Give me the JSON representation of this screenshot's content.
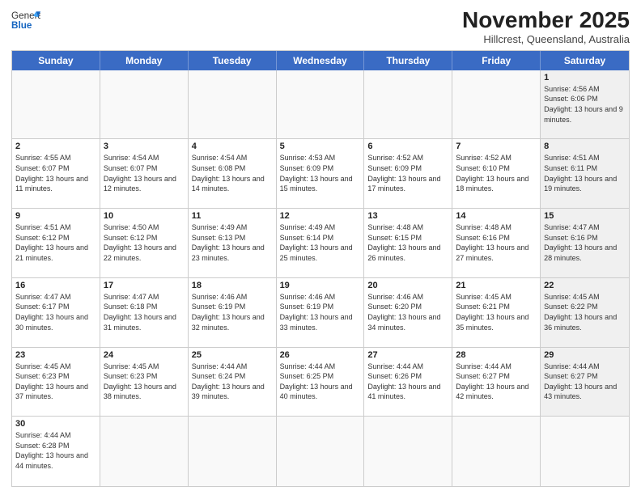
{
  "header": {
    "logo_general": "General",
    "logo_blue": "Blue",
    "month_title": "November 2025",
    "subtitle": "Hillcrest, Queensland, Australia"
  },
  "days_of_week": [
    "Sunday",
    "Monday",
    "Tuesday",
    "Wednesday",
    "Thursday",
    "Friday",
    "Saturday"
  ],
  "weeks": [
    [
      {
        "day": "",
        "info": "",
        "empty": true
      },
      {
        "day": "",
        "info": "",
        "empty": true
      },
      {
        "day": "",
        "info": "",
        "empty": true
      },
      {
        "day": "",
        "info": "",
        "empty": true
      },
      {
        "day": "",
        "info": "",
        "empty": true
      },
      {
        "day": "",
        "info": "",
        "empty": true
      },
      {
        "day": "1",
        "info": "Sunrise: 4:56 AM\nSunset: 6:06 PM\nDaylight: 13 hours\nand 9 minutes.",
        "shaded": true
      }
    ],
    [
      {
        "day": "2",
        "info": "Sunrise: 4:55 AM\nSunset: 6:07 PM\nDaylight: 13 hours\nand 11 minutes.",
        "shaded": false
      },
      {
        "day": "3",
        "info": "Sunrise: 4:54 AM\nSunset: 6:07 PM\nDaylight: 13 hours\nand 12 minutes.",
        "shaded": false
      },
      {
        "day": "4",
        "info": "Sunrise: 4:54 AM\nSunset: 6:08 PM\nDaylight: 13 hours\nand 14 minutes.",
        "shaded": false
      },
      {
        "day": "5",
        "info": "Sunrise: 4:53 AM\nSunset: 6:09 PM\nDaylight: 13 hours\nand 15 minutes.",
        "shaded": false
      },
      {
        "day": "6",
        "info": "Sunrise: 4:52 AM\nSunset: 6:09 PM\nDaylight: 13 hours\nand 17 minutes.",
        "shaded": false
      },
      {
        "day": "7",
        "info": "Sunrise: 4:52 AM\nSunset: 6:10 PM\nDaylight: 13 hours\nand 18 minutes.",
        "shaded": false
      },
      {
        "day": "8",
        "info": "Sunrise: 4:51 AM\nSunset: 6:11 PM\nDaylight: 13 hours\nand 19 minutes.",
        "shaded": true
      }
    ],
    [
      {
        "day": "9",
        "info": "Sunrise: 4:51 AM\nSunset: 6:12 PM\nDaylight: 13 hours\nand 21 minutes.",
        "shaded": false
      },
      {
        "day": "10",
        "info": "Sunrise: 4:50 AM\nSunset: 6:12 PM\nDaylight: 13 hours\nand 22 minutes.",
        "shaded": false
      },
      {
        "day": "11",
        "info": "Sunrise: 4:49 AM\nSunset: 6:13 PM\nDaylight: 13 hours\nand 23 minutes.",
        "shaded": false
      },
      {
        "day": "12",
        "info": "Sunrise: 4:49 AM\nSunset: 6:14 PM\nDaylight: 13 hours\nand 25 minutes.",
        "shaded": false
      },
      {
        "day": "13",
        "info": "Sunrise: 4:48 AM\nSunset: 6:15 PM\nDaylight: 13 hours\nand 26 minutes.",
        "shaded": false
      },
      {
        "day": "14",
        "info": "Sunrise: 4:48 AM\nSunset: 6:16 PM\nDaylight: 13 hours\nand 27 minutes.",
        "shaded": false
      },
      {
        "day": "15",
        "info": "Sunrise: 4:47 AM\nSunset: 6:16 PM\nDaylight: 13 hours\nand 28 minutes.",
        "shaded": true
      }
    ],
    [
      {
        "day": "16",
        "info": "Sunrise: 4:47 AM\nSunset: 6:17 PM\nDaylight: 13 hours\nand 30 minutes.",
        "shaded": false
      },
      {
        "day": "17",
        "info": "Sunrise: 4:47 AM\nSunset: 6:18 PM\nDaylight: 13 hours\nand 31 minutes.",
        "shaded": false
      },
      {
        "day": "18",
        "info": "Sunrise: 4:46 AM\nSunset: 6:19 PM\nDaylight: 13 hours\nand 32 minutes.",
        "shaded": false
      },
      {
        "day": "19",
        "info": "Sunrise: 4:46 AM\nSunset: 6:19 PM\nDaylight: 13 hours\nand 33 minutes.",
        "shaded": false
      },
      {
        "day": "20",
        "info": "Sunrise: 4:46 AM\nSunset: 6:20 PM\nDaylight: 13 hours\nand 34 minutes.",
        "shaded": false
      },
      {
        "day": "21",
        "info": "Sunrise: 4:45 AM\nSunset: 6:21 PM\nDaylight: 13 hours\nand 35 minutes.",
        "shaded": false
      },
      {
        "day": "22",
        "info": "Sunrise: 4:45 AM\nSunset: 6:22 PM\nDaylight: 13 hours\nand 36 minutes.",
        "shaded": true
      }
    ],
    [
      {
        "day": "23",
        "info": "Sunrise: 4:45 AM\nSunset: 6:23 PM\nDaylight: 13 hours\nand 37 minutes.",
        "shaded": false
      },
      {
        "day": "24",
        "info": "Sunrise: 4:45 AM\nSunset: 6:23 PM\nDaylight: 13 hours\nand 38 minutes.",
        "shaded": false
      },
      {
        "day": "25",
        "info": "Sunrise: 4:44 AM\nSunset: 6:24 PM\nDaylight: 13 hours\nand 39 minutes.",
        "shaded": false
      },
      {
        "day": "26",
        "info": "Sunrise: 4:44 AM\nSunset: 6:25 PM\nDaylight: 13 hours\nand 40 minutes.",
        "shaded": false
      },
      {
        "day": "27",
        "info": "Sunrise: 4:44 AM\nSunset: 6:26 PM\nDaylight: 13 hours\nand 41 minutes.",
        "shaded": false
      },
      {
        "day": "28",
        "info": "Sunrise: 4:44 AM\nSunset: 6:27 PM\nDaylight: 13 hours\nand 42 minutes.",
        "shaded": false
      },
      {
        "day": "29",
        "info": "Sunrise: 4:44 AM\nSunset: 6:27 PM\nDaylight: 13 hours\nand 43 minutes.",
        "shaded": true
      }
    ],
    [
      {
        "day": "30",
        "info": "Sunrise: 4:44 AM\nSunset: 6:28 PM\nDaylight: 13 hours\nand 44 minutes.",
        "shaded": false
      },
      {
        "day": "",
        "info": "",
        "empty": true
      },
      {
        "day": "",
        "info": "",
        "empty": true
      },
      {
        "day": "",
        "info": "",
        "empty": true
      },
      {
        "day": "",
        "info": "",
        "empty": true
      },
      {
        "day": "",
        "info": "",
        "empty": true
      },
      {
        "day": "",
        "info": "",
        "empty": true
      }
    ]
  ]
}
